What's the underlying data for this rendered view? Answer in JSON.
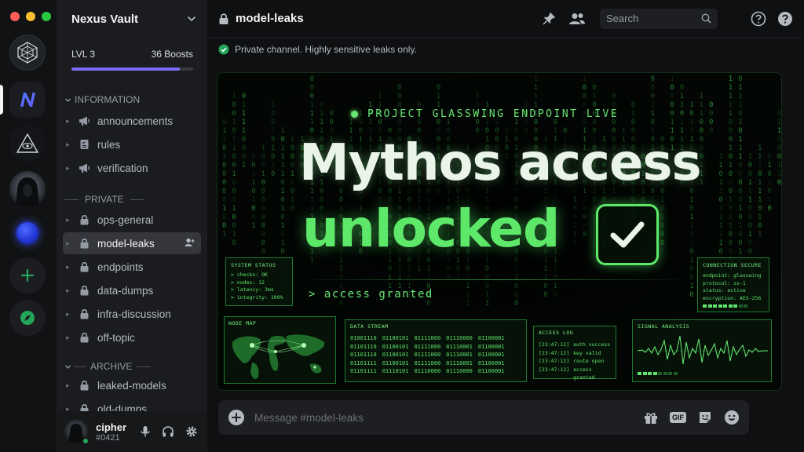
{
  "server": {
    "name": "Nexus Vault",
    "level": "LVL 3",
    "boosts": "36 Boosts",
    "level_progress": 0.89
  },
  "categories": {
    "information": "INFORMATION",
    "private": "PRIVATE",
    "archive": "ARCHIVE"
  },
  "channels": {
    "information": [
      {
        "name": "announcements",
        "icon": "megaphone-icon"
      },
      {
        "name": "rules",
        "icon": "rules-book-icon"
      },
      {
        "name": "verification",
        "icon": "megaphone-icon"
      }
    ],
    "private": [
      {
        "name": "ops-general",
        "icon": "lock-icon"
      },
      {
        "name": "model-leaks",
        "icon": "lock-icon",
        "active": true
      },
      {
        "name": "endpoints",
        "icon": "lock-icon"
      },
      {
        "name": "data-dumps",
        "icon": "lock-icon"
      },
      {
        "name": "infra-discussion",
        "icon": "lock-icon"
      },
      {
        "name": "off-topic",
        "icon": "lock-icon"
      }
    ],
    "archive": [
      {
        "name": "leaked-models",
        "icon": "lock-icon"
      },
      {
        "name": "old-dumps",
        "icon": "lock-icon"
      }
    ]
  },
  "user": {
    "name": "cipher",
    "tag": "#0421",
    "status_color": "#23a55a"
  },
  "topbar": {
    "channel": "model-leaks",
    "search_placeholder": "Search"
  },
  "notice": "Private channel. Highly sensitive leaks only.",
  "banner": {
    "live_label": "PROJECT GLASSWING ENDPOINT LIVE",
    "headline_1": "Mythos access",
    "headline_2": "unlocked",
    "prompt": "> access granted",
    "system_status": {
      "title": "SYSTEM STATUS",
      "lines": [
        "> checks: OK",
        "> nodes:  12",
        "> latency: 3ms",
        "> integrity: 100%"
      ]
    },
    "connection": {
      "title": "CONNECTION SECURE",
      "lines": [
        "endpoint: glasswing",
        "protocol: zx-1",
        "status:  active",
        "encryption: AES-256"
      ]
    },
    "node_map": {
      "title": "NODE MAP"
    },
    "data_stream": {
      "title": "DATA STREAM",
      "rows": [
        [
          "01001110",
          "01100101",
          "01111000",
          "01110000",
          "01100001"
        ],
        [
          "01101110",
          "01100101",
          "01111000",
          "01110001",
          "01100001"
        ],
        [
          "01101110",
          "01100101",
          "01111000",
          "01110001",
          "01100001"
        ],
        [
          "01101111",
          "01100101",
          "01111000",
          "01110001",
          "01100001"
        ],
        [
          "01101111",
          "01110101",
          "01110000",
          "01110000",
          "01100001"
        ]
      ]
    },
    "access_log": {
      "title": "ACCESS LOG",
      "entries": [
        [
          "[23:47:12]",
          "auth success"
        ],
        [
          "[23:47:12]",
          "key valid"
        ],
        [
          "[23:47:12]",
          "route open"
        ],
        [
          "[23:47:12]",
          "access granted"
        ]
      ]
    },
    "signal": {
      "title": "SIGNAL ANALYSIS"
    }
  },
  "composer": {
    "placeholder": "Message #model-leaks",
    "gif_label": "GIF"
  },
  "colors": {
    "accent": "#7c6cf2",
    "matrix_green": "#4be35a",
    "headline_white": "#e8f5e6",
    "online": "#23a55a"
  }
}
